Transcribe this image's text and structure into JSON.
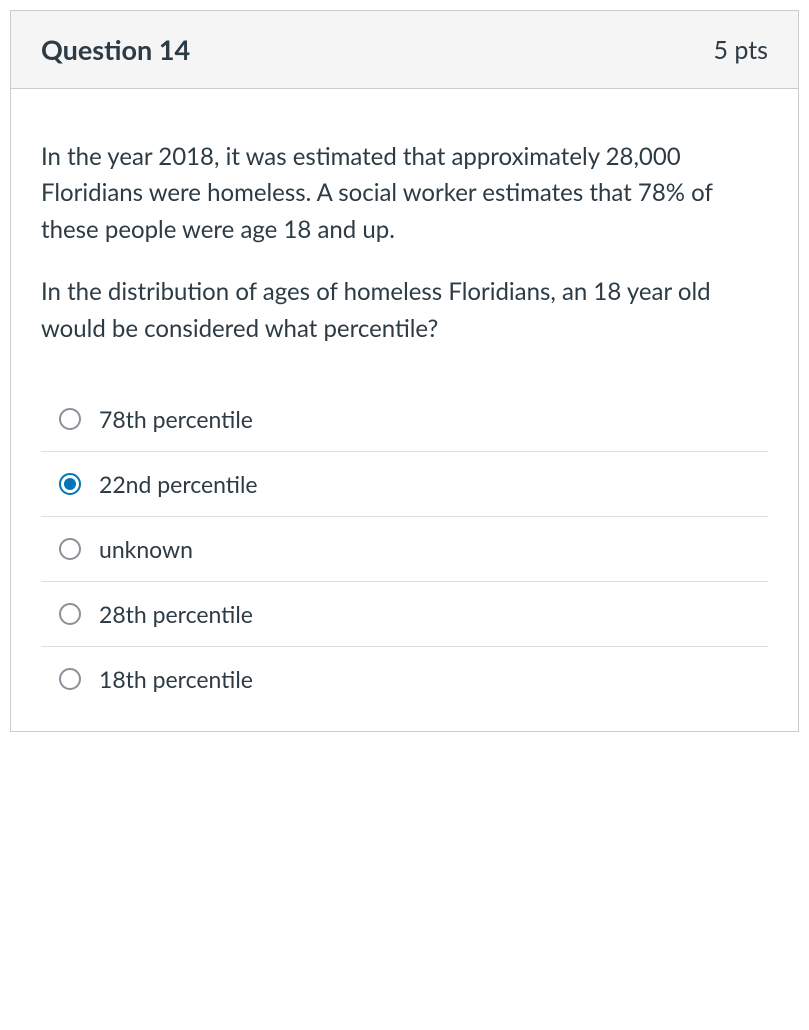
{
  "header": {
    "title": "Question 14",
    "points": "5 pts"
  },
  "question": {
    "paragraph1": "In the year 2018, it was estimated that approximately 28,000 Floridians were homeless. A social worker estimates that 78% of these people were age 18 and up.",
    "paragraph2": "In the distribution of ages of homeless Floridians, an 18 year old would be considered what percentile?"
  },
  "answers": [
    {
      "label": "78th percentile",
      "checked": false
    },
    {
      "label": "22nd percentile",
      "checked": true
    },
    {
      "label": "unknown",
      "checked": false
    },
    {
      "label": "28th percentile",
      "checked": false
    },
    {
      "label": "18th percentile",
      "checked": false
    }
  ]
}
